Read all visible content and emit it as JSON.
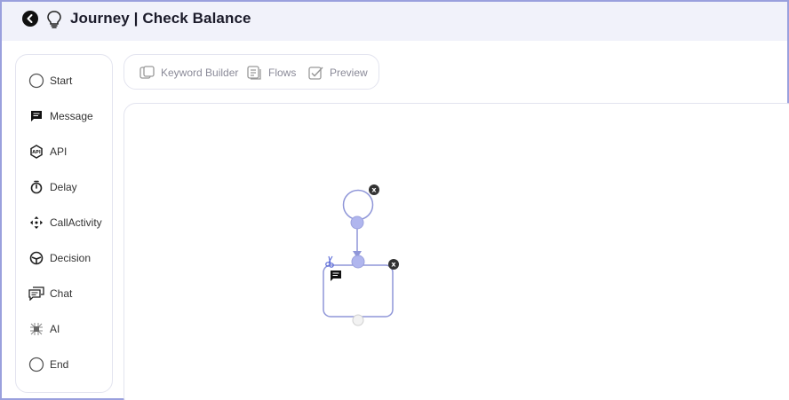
{
  "header": {
    "title": "Journey | Check Balance",
    "back_icon": "back-arrow-icon",
    "bulb_icon": "lightbulb-icon"
  },
  "sidebar": {
    "items": [
      {
        "label": "Start",
        "icon": "circle-icon"
      },
      {
        "label": "Message",
        "icon": "message-icon"
      },
      {
        "label": "API",
        "icon": "api-icon"
      },
      {
        "label": "Delay",
        "icon": "timer-icon"
      },
      {
        "label": "CallActivity",
        "icon": "call-activity-icon"
      },
      {
        "label": "Decision",
        "icon": "decision-icon"
      },
      {
        "label": "Chat",
        "icon": "chat-icon"
      },
      {
        "label": "AI",
        "icon": "ai-icon"
      },
      {
        "label": "End",
        "icon": "circle-icon"
      }
    ]
  },
  "toolbar": {
    "keyword_builder": "Keyword Builder",
    "flows": "Flows",
    "preview": "Preview"
  },
  "canvas": {
    "close_label": "x",
    "accent": "#8f96d8"
  }
}
